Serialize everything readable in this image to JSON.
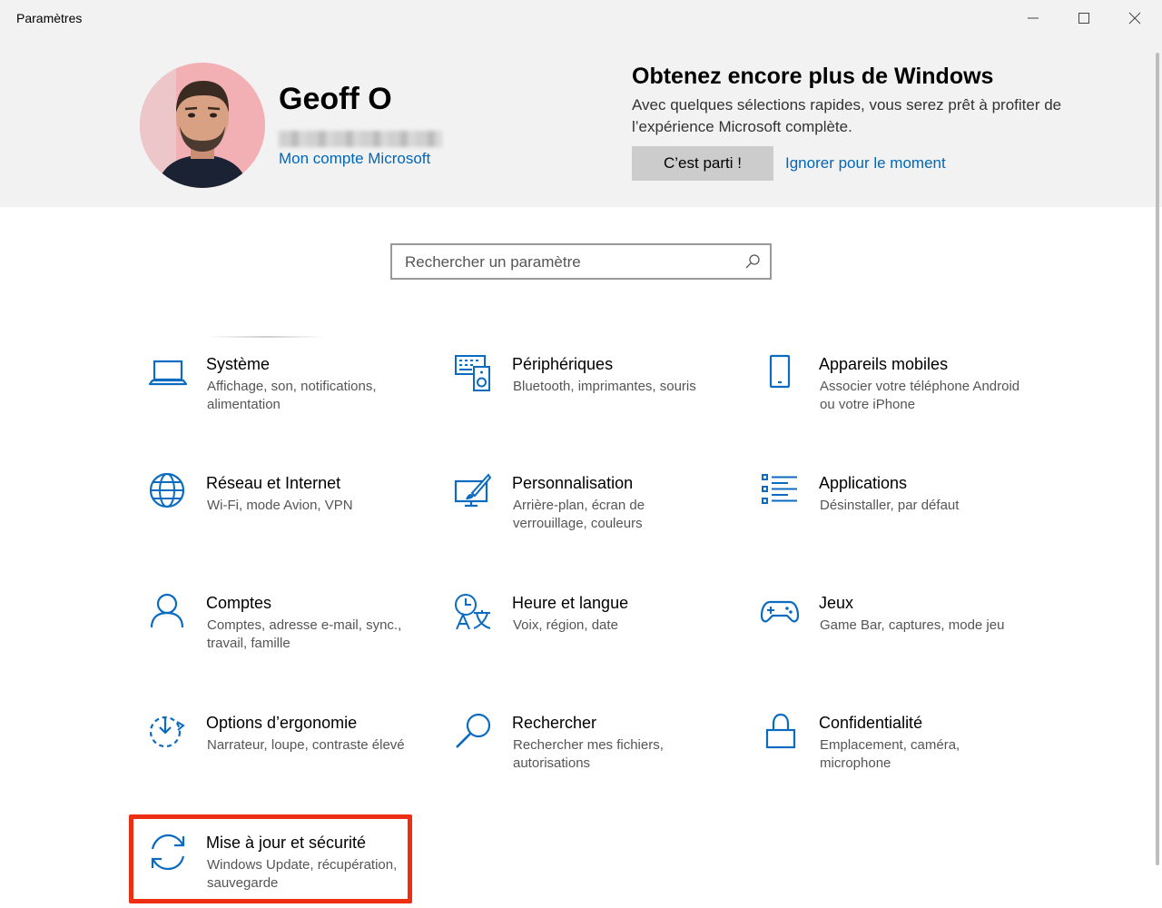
{
  "window": {
    "title": "Paramètres"
  },
  "header": {
    "user_name": "Geoff O",
    "account_link": "Mon compte Microsoft",
    "promo_title": "Obtenez encore plus de Windows",
    "promo_text": "Avec quelques sélections rapides, vous serez prêt à profiter de l’expérience Microsoft complète.",
    "start_button": "C’est parti !",
    "skip_link": "Ignorer pour le moment"
  },
  "search": {
    "placeholder": "Rechercher un paramètre"
  },
  "colors": {
    "accent": "#0067b8",
    "icon": "#0a6bc1",
    "highlight": "#ee2e12"
  },
  "tiles": [
    {
      "title": "Système",
      "desc": "Affichage, son, notifications, alimentation",
      "icon": "laptop-icon"
    },
    {
      "title": "Périphériques",
      "desc": "Bluetooth, imprimantes, souris",
      "icon": "devices-icon"
    },
    {
      "title": "Appareils mobiles",
      "desc": "Associer votre téléphone Android ou votre iPhone",
      "icon": "phone-icon"
    },
    {
      "title": "Réseau et Internet",
      "desc": "Wi-Fi, mode Avion, VPN",
      "icon": "globe-icon"
    },
    {
      "title": "Personnalisation",
      "desc": "Arrière-plan, écran de verrouillage, couleurs",
      "icon": "paintbrush-icon"
    },
    {
      "title": "Applications",
      "desc": "Désinstaller, par défaut",
      "icon": "app-list-icon"
    },
    {
      "title": "Comptes",
      "desc": "Comptes, adresse e-mail, sync., travail, famille",
      "icon": "person-icon"
    },
    {
      "title": "Heure et langue",
      "desc": "Voix, région, date",
      "icon": "time-language-icon"
    },
    {
      "title": "Jeux",
      "desc": "Game Bar, captures, mode jeu",
      "icon": "gamepad-icon"
    },
    {
      "title": "Options d’ergonomie",
      "desc": "Narrateur, loupe, contraste élevé",
      "icon": "ease-of-access-icon"
    },
    {
      "title": "Rechercher",
      "desc": "Rechercher mes fichiers, autorisations",
      "icon": "search-icon"
    },
    {
      "title": "Confidentialité",
      "desc": "Emplacement, caméra, microphone",
      "icon": "lock-icon"
    },
    {
      "title": "Mise à jour et sécurité",
      "desc": "Windows Update, récupération, sauvegarde",
      "icon": "update-sync-icon"
    }
  ]
}
